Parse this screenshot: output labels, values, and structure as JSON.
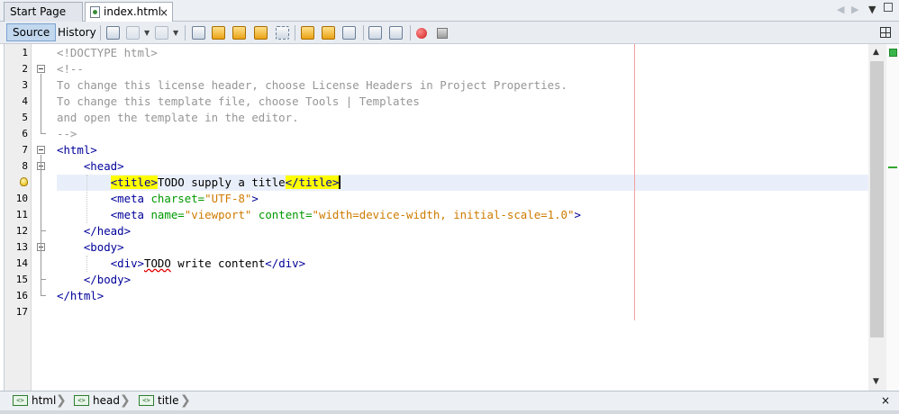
{
  "tabs": [
    {
      "label": "Start Page",
      "active": false
    },
    {
      "label": "index.html",
      "active": true
    }
  ],
  "tab_close_glyph": "×",
  "toolbar": {
    "source_label": "Source",
    "history_label": "History"
  },
  "editor": {
    "line_numbers": [
      "1",
      "2",
      "3",
      "4",
      "5",
      "6",
      "7",
      "8",
      "9",
      "10",
      "11",
      "12",
      "13",
      "14",
      "15",
      "16",
      "17"
    ],
    "lines": {
      "l1": "<!DOCTYPE html>",
      "l2": "<!--",
      "l3": "To change this license header, choose License Headers in Project Properties.",
      "l4": "To change this template file, choose Tools | Templates",
      "l5": "and open the template in the editor.",
      "l6": "-->",
      "l7_tag": "<html>",
      "l8_tag": "<head>",
      "l9_open": "<title>",
      "l9_todo": "TODO",
      "l9_text": " supply a title",
      "l9_close": "</title>",
      "l10_tag": "<meta",
      "l10_attr": "charset=",
      "l10_val": "\"UTF-8\"",
      "l10_end": ">",
      "l11_tag": "<meta",
      "l11_attr1": "name=",
      "l11_val1": "\"viewport\"",
      "l11_attr2": "content=",
      "l11_val2": "\"width=device-width, initial-scale=1.0\"",
      "l11_end": ">",
      "l12_tag": "</head>",
      "l13_tag": "<body>",
      "l14_open": "<div>",
      "l14_todo": "TODO",
      "l14_text": " write content",
      "l14_close": "</div>",
      "l15_tag": "</body>",
      "l16_tag": "</html>"
    }
  },
  "breadcrumbs": [
    "html",
    "head",
    "title"
  ],
  "breadcrumb_icon_text": "<>",
  "colors": {
    "tag": "#000099",
    "attribute": "#009900",
    "value": "#ce7b00",
    "comment": "#969696",
    "match_highlight": "#ffff00",
    "current_line": "#e9effa",
    "active_mode": "#c2d8ef"
  }
}
